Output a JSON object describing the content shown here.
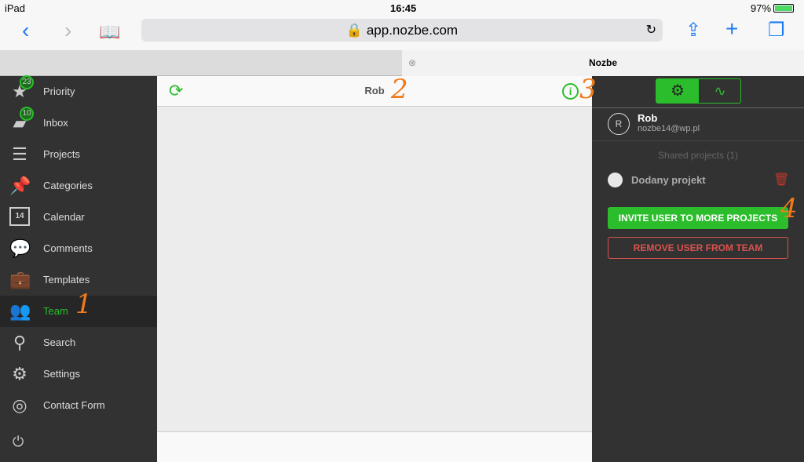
{
  "status": {
    "device": "iPad",
    "time": "16:45",
    "battery": "97%"
  },
  "browser": {
    "url": "app.nozbe.com",
    "tab_title": "Nozbe"
  },
  "sidebar": {
    "items": [
      {
        "label": "Priority",
        "icon": "star-icon",
        "badge": "23"
      },
      {
        "label": "Inbox",
        "icon": "inbox-icon",
        "badge": "10"
      },
      {
        "label": "Projects",
        "icon": "projects-icon"
      },
      {
        "label": "Categories",
        "icon": "pin-icon"
      },
      {
        "label": "Calendar",
        "icon": "calendar-icon",
        "icon_text": "14"
      },
      {
        "label": "Comments",
        "icon": "comments-icon"
      },
      {
        "label": "Templates",
        "icon": "briefcase-icon"
      },
      {
        "label": "Team",
        "icon": "team-icon",
        "active": true
      },
      {
        "label": "Search",
        "icon": "search-icon"
      },
      {
        "label": "Settings",
        "icon": "gear-icon"
      },
      {
        "label": "Contact Form",
        "icon": "lifebuoy-icon"
      }
    ]
  },
  "main": {
    "title": "Rob"
  },
  "panel": {
    "user_initial": "R",
    "user_name": "Rob",
    "user_email": "nozbe14@wp.pl",
    "shared_header": "Shared projects (1)",
    "project": "Dodany projekt",
    "invite_label": "INVITE USER TO MORE PROJECTS",
    "remove_label": "REMOVE USER FROM TEAM"
  },
  "annotations": [
    "1",
    "2",
    "3",
    "4"
  ],
  "colors": {
    "accent": "#2bbd2b",
    "danger": "#d9534f"
  }
}
